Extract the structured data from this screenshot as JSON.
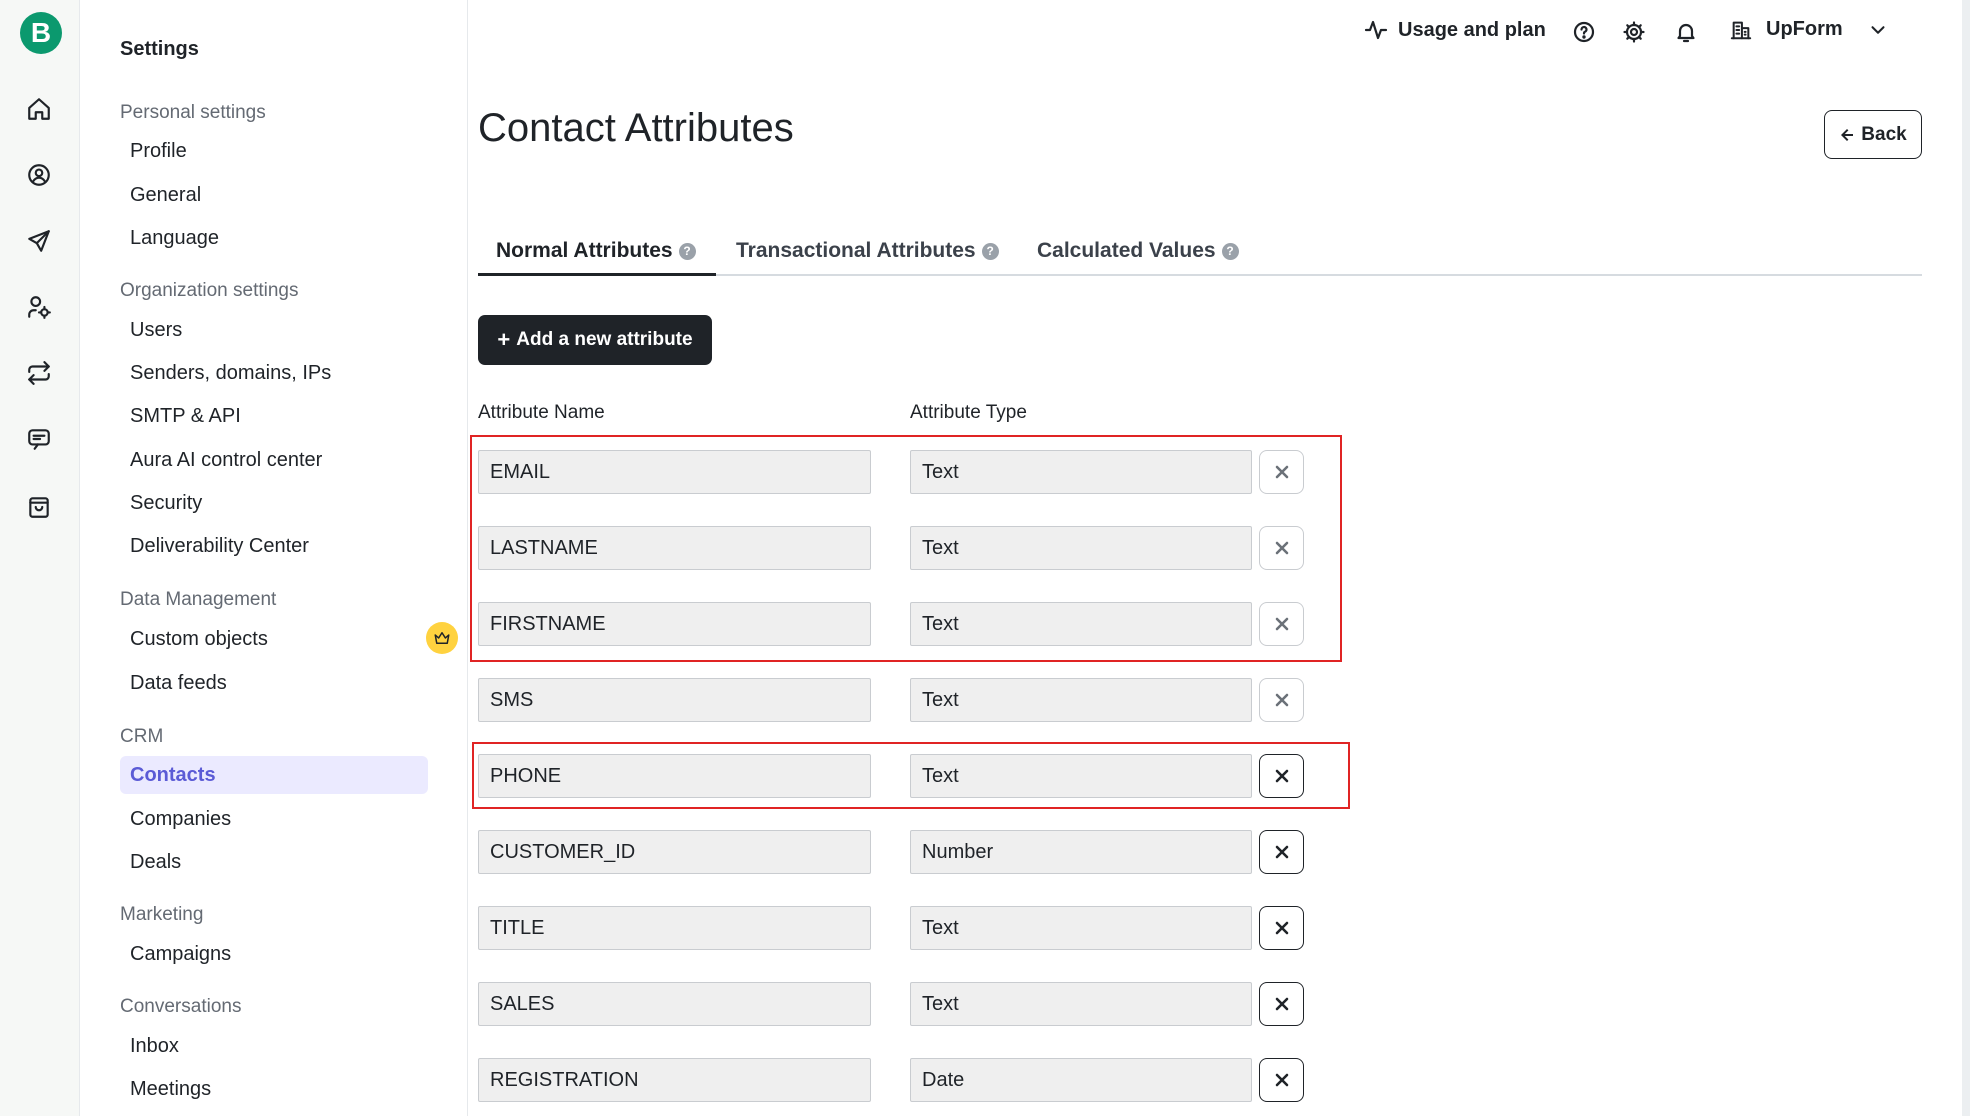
{
  "rail": {
    "logo": "B",
    "icons": [
      "home-icon",
      "contacts-icon",
      "campaigns-icon",
      "automation-icon",
      "transactional-icon",
      "conversations-icon",
      "commerce-icon"
    ]
  },
  "sidebar": {
    "title": "Settings",
    "sections": {
      "personal": {
        "heading": "Personal settings",
        "items": [
          "Profile",
          "General",
          "Language"
        ]
      },
      "organization": {
        "heading": "Organization settings",
        "items": [
          "Users",
          "Senders, domains, IPs",
          "SMTP & API",
          "Aura AI control center",
          "Security",
          "Deliverability Center"
        ]
      },
      "data": {
        "heading": "Data Management",
        "items": [
          "Custom objects",
          "Data feeds"
        ]
      },
      "crm": {
        "heading": "CRM",
        "items": [
          "Contacts",
          "Companies",
          "Deals"
        ]
      },
      "marketing": {
        "heading": "Marketing",
        "items": [
          "Campaigns"
        ]
      },
      "conversations": {
        "heading": "Conversations",
        "items": [
          "Inbox",
          "Meetings"
        ]
      }
    }
  },
  "topbar": {
    "usage_label": "Usage and plan",
    "org_name": "UpForm"
  },
  "main": {
    "title": "Contact Attributes",
    "back_label": "Back",
    "tabs": [
      "Normal Attributes",
      "Transactional Attributes",
      "Calculated Values"
    ],
    "add_label": "Add a new attribute",
    "columns": {
      "name": "Attribute Name",
      "type": "Attribute Type"
    },
    "rows": [
      {
        "name": "EMAIL",
        "type": "Text"
      },
      {
        "name": "LASTNAME",
        "type": "Text"
      },
      {
        "name": "FIRSTNAME",
        "type": "Text"
      },
      {
        "name": "SMS",
        "type": "Text"
      },
      {
        "name": "PHONE",
        "type": "Text"
      },
      {
        "name": "CUSTOMER_ID",
        "type": "Number"
      },
      {
        "name": "TITLE",
        "type": "Text"
      },
      {
        "name": "SALES",
        "type": "Text"
      },
      {
        "name": "REGISTRATION",
        "type": "Date"
      }
    ]
  },
  "colors": {
    "brand": "#0b996e",
    "accent": "#5b5bd6",
    "highlight": "#e02424",
    "primary_button": "#1f2328"
  }
}
